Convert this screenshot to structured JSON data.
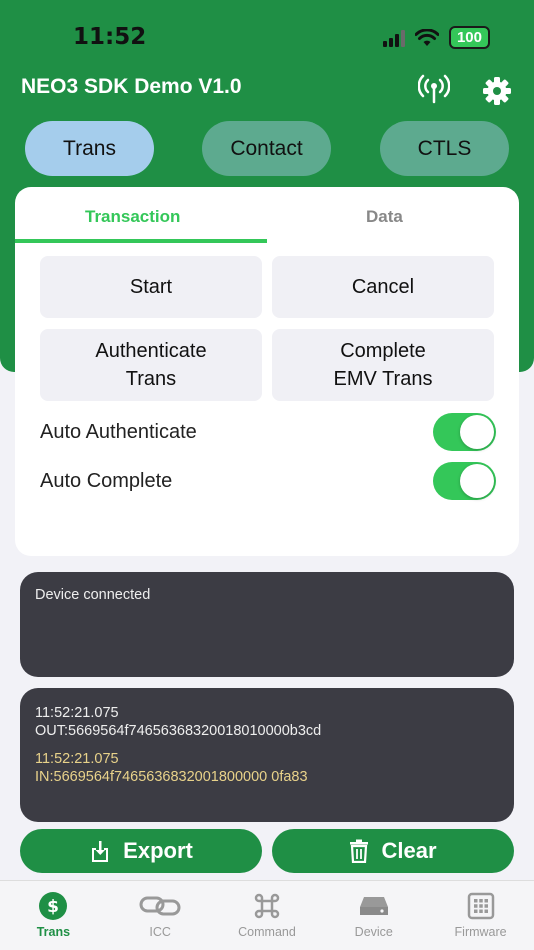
{
  "status": {
    "time": "11:52",
    "battery": "100"
  },
  "header": {
    "title": "NEO3 SDK Demo V1.0"
  },
  "mode_tabs": [
    "Trans",
    "Contact",
    "CTLS"
  ],
  "card": {
    "tabs": [
      "Transaction",
      "Data"
    ],
    "buttons": {
      "start": "Start",
      "cancel": "Cancel",
      "authenticate_line1": "Authenticate",
      "authenticate_line2": "Trans",
      "complete_line1": "Complete",
      "complete_line2": "EMV Trans"
    },
    "toggles": [
      {
        "label": "Auto Authenticate",
        "on": true
      },
      {
        "label": "Auto Complete",
        "on": true
      }
    ]
  },
  "status_log": "Device connected",
  "comm_log": {
    "out_time": "11:52:21.075",
    "out_data": "OUT:5669564f74656368320018010000b3cd",
    "in_time": "11:52:21.075",
    "in_data": "IN:5669564f7465636832001800000 0fa83"
  },
  "actions": {
    "export": "Export",
    "clear": "Clear"
  },
  "tabbar": [
    "Trans",
    "ICC",
    "Command",
    "Device",
    "Firmware"
  ],
  "colors": {
    "primary_green": "#1f8f45",
    "accent_green": "#34c759",
    "active_pill": "#a5cdec",
    "log_bg": "#3c3c44"
  }
}
